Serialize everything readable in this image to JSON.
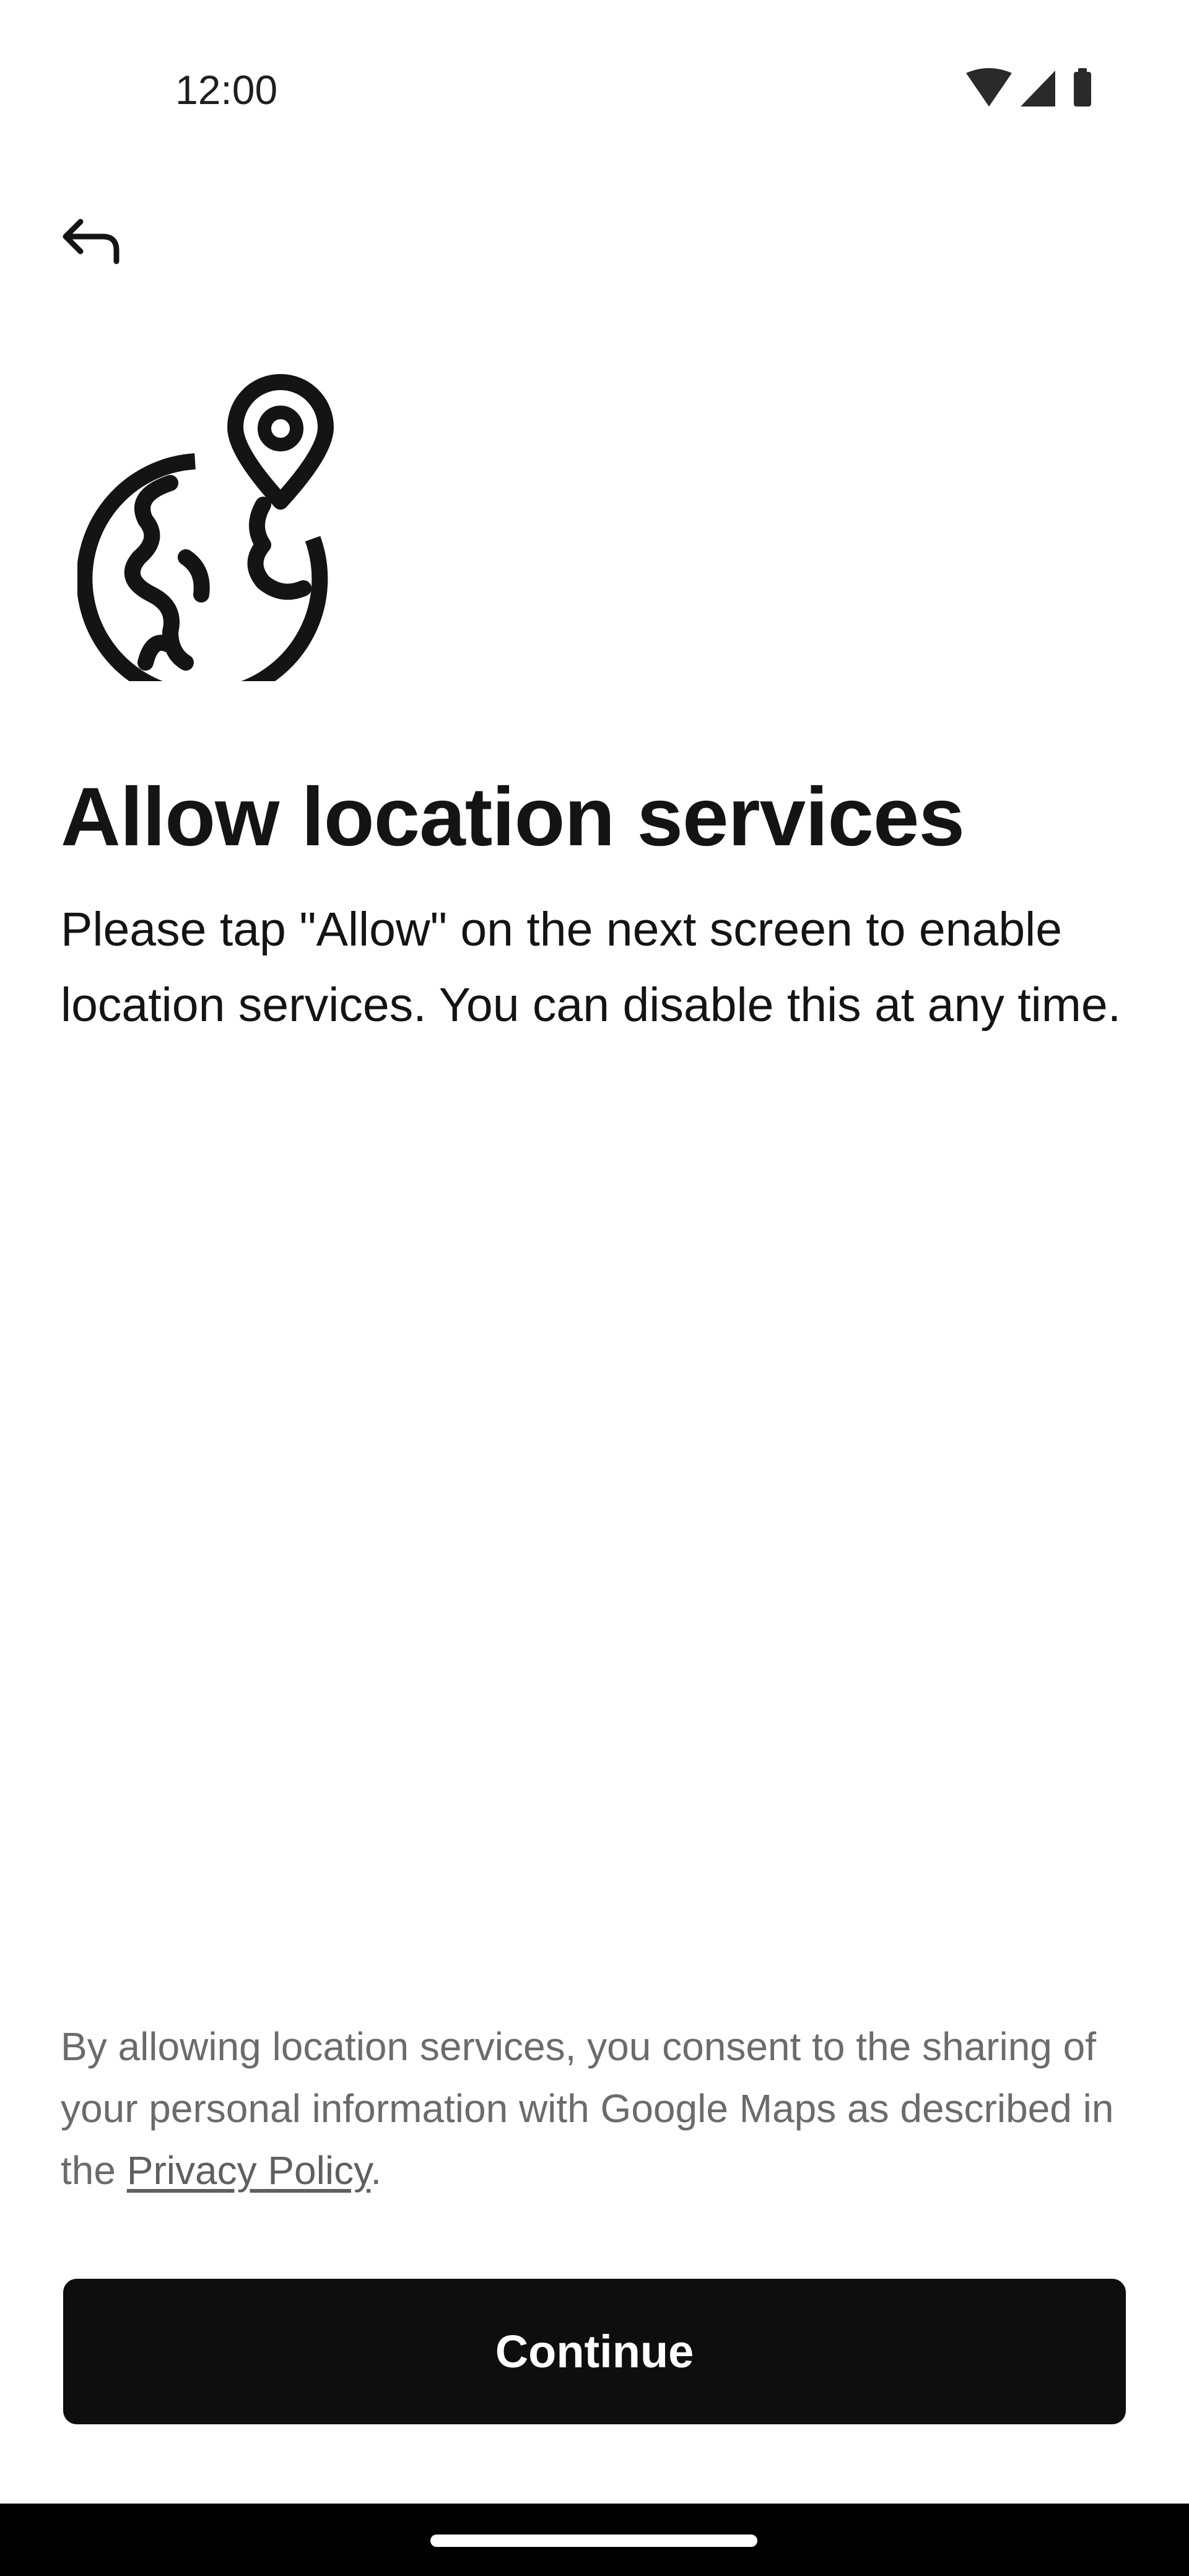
{
  "status_bar": {
    "time": "12:00",
    "icons": [
      "wifi-icon",
      "signal-icon",
      "battery-icon"
    ]
  },
  "header": {
    "back_icon": "back-arrow-icon"
  },
  "hero": {
    "icon": "globe-location-pin-icon"
  },
  "content": {
    "title": "Allow location services",
    "description": "Please tap \"Allow\" on the next screen to enable location services. You can disable this at any time."
  },
  "consent": {
    "text_before": "By allowing location services, you consent to the sharing of your personal information with Google Maps as described in the ",
    "link_text": "Privacy Policy",
    "text_after": "."
  },
  "actions": {
    "continue_label": "Continue"
  },
  "colors": {
    "primary_button": "#0e0e0e",
    "text": "#141414",
    "secondary_text": "#6b6b6b",
    "nav_bar": "#000000"
  }
}
